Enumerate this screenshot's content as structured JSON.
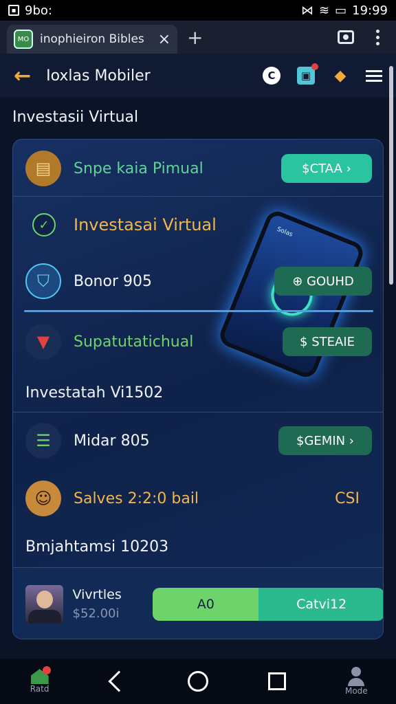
{
  "status_bar": {
    "left_text": "9bo:",
    "time": "19:99"
  },
  "browser": {
    "tab_title": "inophieiron Bibles",
    "tab_favicon_text": "MO",
    "close_icon": "close-icon",
    "new_tab_icon": "plus-icon"
  },
  "header": {
    "title": "Ioxlas Mobiler",
    "icon_c_text": "C"
  },
  "section_title": "Investasii Virtual",
  "card": {
    "rows": [
      {
        "label": "Snpe kaia Pimual",
        "button": "$CTAA ›",
        "label_color": "#5fd39a",
        "icon": "store-icon",
        "icon_bg": "#b07a2a"
      },
      {
        "label": "Investasai Virtual",
        "label_color": "#f2b64a",
        "icon": "check-circle-icon",
        "icon_bg": "#0f2249"
      },
      {
        "label": "Bonor 905",
        "button": "⊕ GOUHD",
        "label_color": "#f2f4fa",
        "icon": "shield-icon",
        "icon_bg": "#1c4a80"
      },
      {
        "label": "Supatutatichual",
        "button": "$ STEAIE",
        "label_color": "#6fd36b",
        "icon": "gift-icon",
        "icon_bg": "#1a2d55"
      },
      {
        "label": "Investatah Vi1502",
        "label_color": "#f2f4fa"
      },
      {
        "label": "Midar 805",
        "button": "$GEMIN ›",
        "label_color": "#f2f4fa",
        "icon": "list-icon",
        "icon_bg": "#1a2d55"
      },
      {
        "label": "Salves 2:2:0 bail",
        "value": "CSI",
        "label_color": "#f2b64a",
        "icon": "avatar-icon",
        "icon_bg": "#c78a3a"
      },
      {
        "label": "Bmjahtamsi 10203",
        "label_color": "#f2f4fa"
      }
    ],
    "phone_screen_text": "Solas",
    "bottom": {
      "title": "Vivrtles",
      "price": "$52.00i",
      "btn_a": "A0",
      "btn_b": "Catvi12"
    }
  },
  "nav": {
    "home_label": "Ratd",
    "profile_label": "Mode"
  },
  "colors": {
    "accent_orange": "#f2a93b",
    "accent_green": "#2bb98e",
    "background": "#0b1326"
  }
}
